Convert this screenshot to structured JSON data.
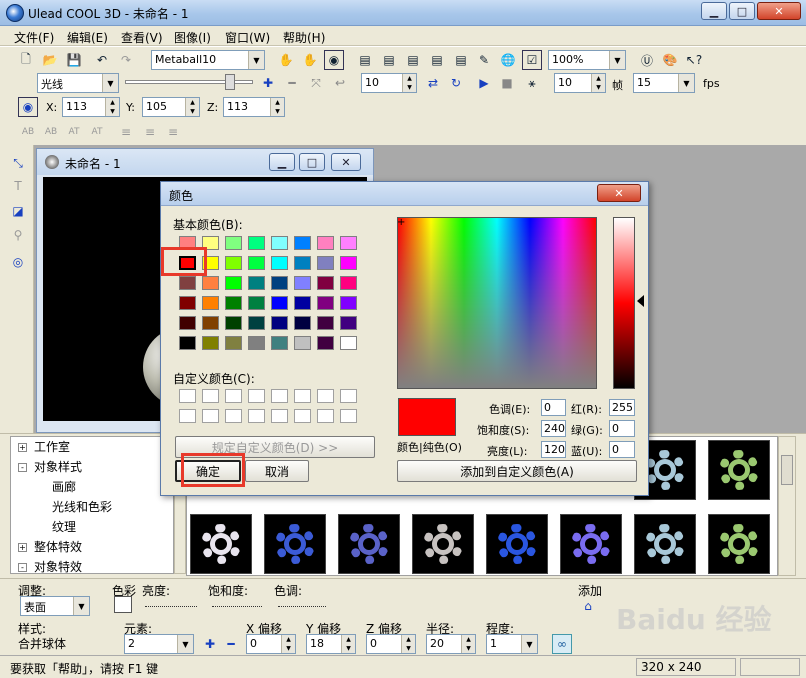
{
  "window": {
    "title": "Ulead COOL 3D - 未命名 - 1"
  },
  "menu": [
    "文件(F)",
    "编辑(E)",
    "查看(V)",
    "图像(I)",
    "窗口(W)",
    "帮助(H)"
  ],
  "toolbar": {
    "object_combo": "Metaball10",
    "zoom_combo": "100%",
    "light_combo": "光线",
    "light_value": "10",
    "frame_value": "10",
    "frame_label": "帧",
    "fps_value": "15",
    "fps_label": "fps",
    "x_label": "X:",
    "x_value": "113",
    "y_label": "Y:",
    "y_value": "105",
    "z_label": "Z:",
    "z_value": "113"
  },
  "doc_window": {
    "title": "未命名 - 1"
  },
  "color_dialog": {
    "title": "颜色",
    "basic_label": "基本颜色(B):",
    "custom_label": "自定义颜色(C):",
    "define_button": "规定自定义颜色(D) >>",
    "ok_button": "确定",
    "cancel_button": "取消",
    "add_button": "添加到自定义颜色(A)",
    "solid_label": "颜色|纯色(O)",
    "hue_label": "色调(E):",
    "hue_value": "0",
    "sat_label": "饱和度(S):",
    "sat_value": "240",
    "lum_label": "亮度(L):",
    "lum_value": "120",
    "red_label": "红(R):",
    "red_value": "255",
    "green_label": "绿(G):",
    "green_value": "0",
    "blue_label": "蓝(U):",
    "blue_value": "0",
    "selected_color": "#ff0000",
    "basic_colors": [
      "#ff8080",
      "#ffff80",
      "#80ff80",
      "#00ff80",
      "#80ffff",
      "#0080ff",
      "#ff80c0",
      "#ff80ff",
      "#ff0000",
      "#ffff00",
      "#80ff00",
      "#00ff40",
      "#00ffff",
      "#0080c0",
      "#8080c0",
      "#ff00ff",
      "#804040",
      "#ff8040",
      "#00ff00",
      "#008080",
      "#004080",
      "#8080ff",
      "#800040",
      "#ff0080",
      "#800000",
      "#ff8000",
      "#008000",
      "#008040",
      "#0000ff",
      "#0000a0",
      "#800080",
      "#8000ff",
      "#400000",
      "#804000",
      "#004000",
      "#004040",
      "#000080",
      "#000040",
      "#400040",
      "#400080",
      "#000000",
      "#808000",
      "#808040",
      "#808080",
      "#408080",
      "#c0c0c0",
      "#400040",
      "#ffffff"
    ]
  },
  "tree": {
    "items": [
      {
        "label": "工作室",
        "expander": "+"
      },
      {
        "label": "对象样式",
        "expander": "-"
      },
      {
        "label": "画廊",
        "expander": ""
      },
      {
        "label": "光线和色彩",
        "expander": ""
      },
      {
        "label": "纹理",
        "expander": ""
      },
      {
        "label": "整体特效",
        "expander": "+"
      },
      {
        "label": "对象特效",
        "expander": "-"
      }
    ]
  },
  "gallery": {
    "gear_colors": [
      "#e8e4ee",
      "#3b5bd6",
      "#5a62c8",
      "#c7c2c0",
      "#2a56e0",
      "#7a6cf0",
      "#a8c8d8",
      "#9ac870"
    ]
  },
  "bottom_panel": {
    "adjust_label": "调整:",
    "adjust_value": "表面",
    "color_label": "色彩",
    "brightness_label": "亮度:",
    "saturation_label": "饱和度:",
    "hue_label": "色调:",
    "add_label": "添加",
    "style_label": "样式:",
    "style_value": "合并球体",
    "element_label": "元素:",
    "element_value": "2",
    "xoff_label": "X 偏移",
    "xoff_value": "0",
    "yoff_label": "Y 偏移",
    "yoff_value": "18",
    "zoff_label": "Z 偏移",
    "zoff_value": "0",
    "radius_label": "半径:",
    "radius_value": "20",
    "degree_label": "程度:",
    "degree_value": "1"
  },
  "status": {
    "hint": "要获取「帮助」，请按 F1 键",
    "size": "320 x 240"
  },
  "watermark": "Baidu 经验"
}
